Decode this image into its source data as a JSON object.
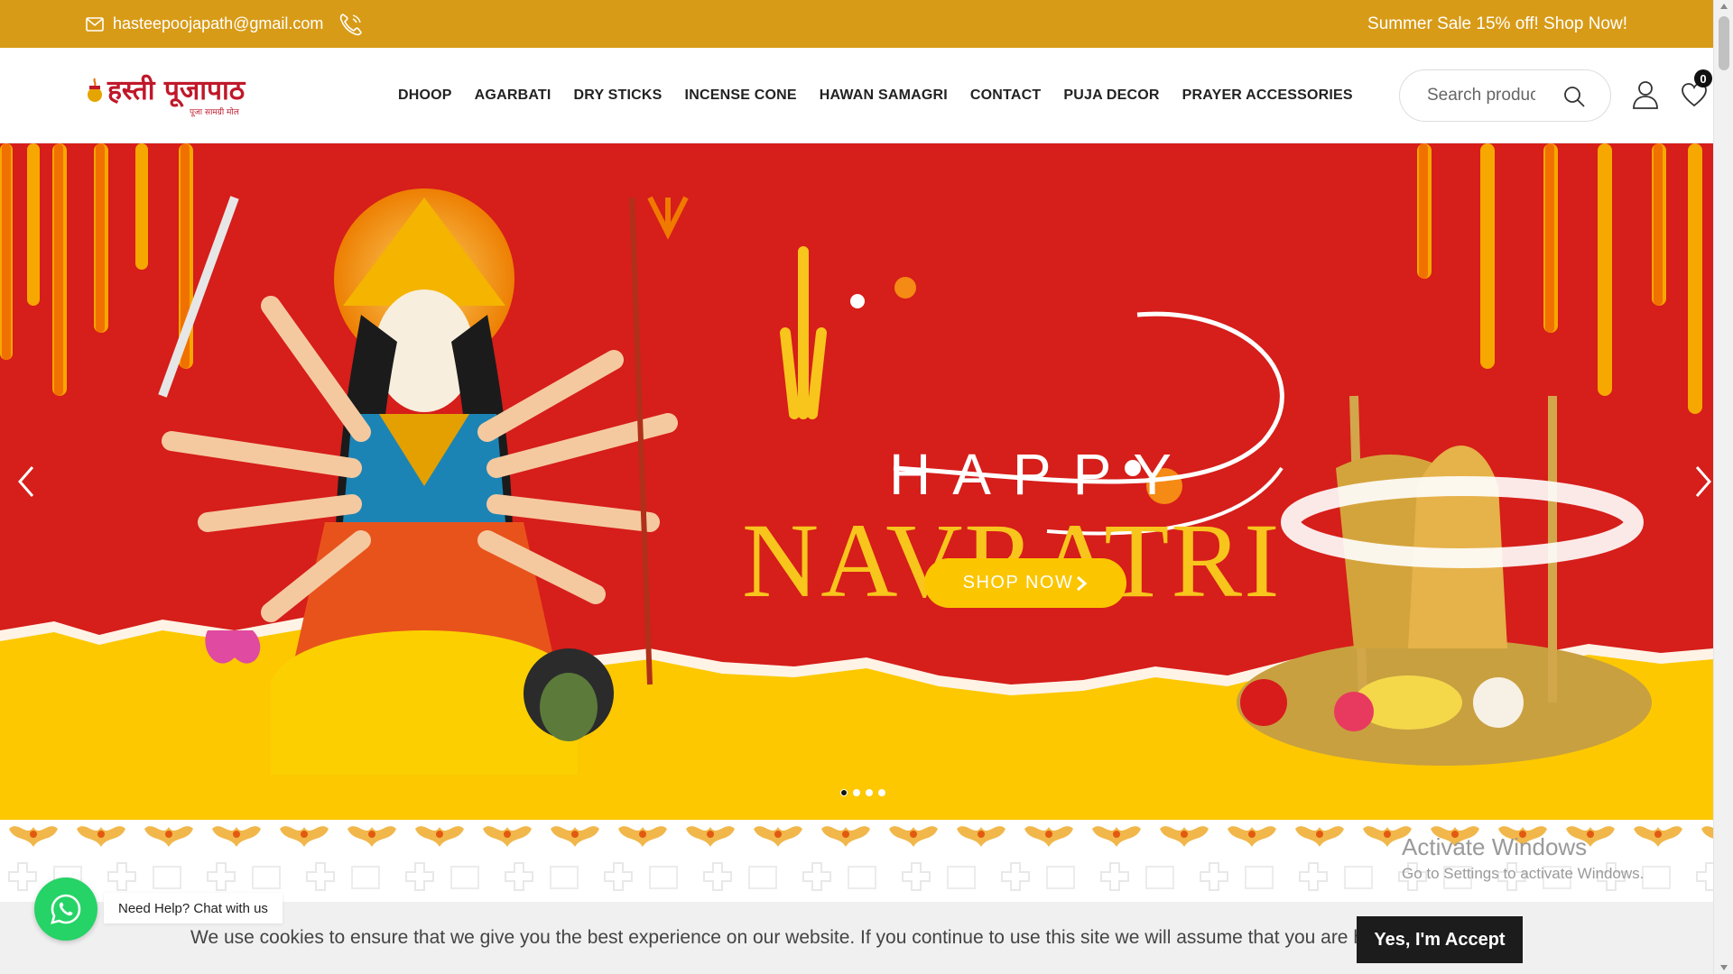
{
  "topbar": {
    "email": "hasteepoojapath@gmail.com",
    "promo": "Summer Sale 15% off! Shop Now!",
    "icons": [
      "mail-icon",
      "phone-icon"
    ],
    "color": "#d89b17"
  },
  "header": {
    "logo_text": "हस्ती पूजापाठ",
    "logo_tagline": "पूजा सामग्री मोल",
    "nav": [
      "DHOOP",
      "AGARBATI",
      "DRY STICKS",
      "INCENSE CONE",
      "HAWAN SAMAGRI",
      "CONTACT",
      "PUJA DECOR",
      "PRAYER ACCESSORIES"
    ],
    "search_placeholder": "Search products",
    "wishlist_count": "0",
    "icons": [
      "search-icon",
      "user-icon",
      "heart-icon"
    ]
  },
  "hero": {
    "heading_small": "HAPPY",
    "heading_large": "NAVRATRI",
    "button_label": "SHOP NOW",
    "slide_count": 4,
    "active_slide": 1,
    "colors": {
      "background": "#d61e1a",
      "accent": "#fbc600"
    }
  },
  "watermark": {
    "line1": "Activate Windows",
    "line2": "Go to Settings to activate Windows."
  },
  "whatsapp": {
    "label": "Need Help? Chat with us",
    "color": "#25d366"
  },
  "cookie": {
    "message": "We use cookies to ensure that we give you the best experience on our website. If you continue to use this site we will assume that you are happy with it.",
    "accept_label": "Yes, I'm Accept"
  }
}
